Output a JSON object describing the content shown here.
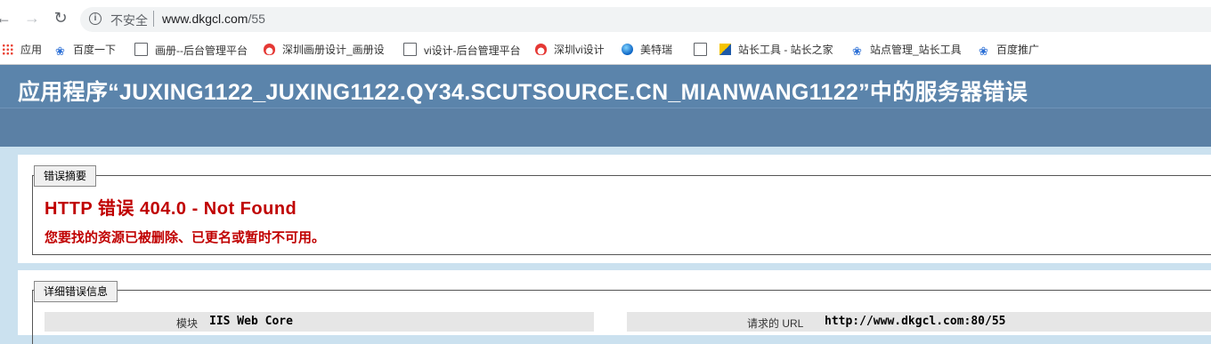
{
  "browser": {
    "security_label": "不安全",
    "url_host": "www.dkgcl.com",
    "url_path": "/55"
  },
  "bookmarks": [
    {
      "icon": "apps-icon",
      "label": "应用"
    },
    {
      "icon": "baidu-paw-icon",
      "label": "百度一下"
    },
    {
      "icon": "page-icon",
      "label": "画册--后台管理平台"
    },
    {
      "icon": "santa-icon",
      "label": "深圳画册设计_画册设"
    },
    {
      "icon": "page-icon",
      "label": "vi设计-后台管理平台"
    },
    {
      "icon": "santa-icon",
      "label": "深圳vi设计"
    },
    {
      "icon": "globe-icon",
      "label": "美特瑞"
    },
    {
      "icon": "page-icon",
      "label": ""
    },
    {
      "icon": "webmaster-tool-icon",
      "label": "站长工具 - 站长之家"
    },
    {
      "icon": "baidu-paw-icon",
      "label": "站点管理_站长工具"
    },
    {
      "icon": "baidu-paw-icon",
      "label": "百度推广"
    }
  ],
  "page": {
    "title": "应用程序“JUXING1122_JUXING1122.QY34.SCUTSOURCE.CN_MIANWANG1122”中的服务器错误",
    "summary_legend": "错误摘要",
    "error_title": "HTTP 错误 404.0 - Not Found",
    "error_message": "您要找的资源已被删除、已更名或暂时不可用。",
    "detail_legend": "详细错误信息",
    "details": {
      "module_label": "模块",
      "module_value": "IIS Web Core",
      "url_label": "请求的 URL",
      "url_value": "http://www.dkgcl.com:80/55"
    }
  }
}
